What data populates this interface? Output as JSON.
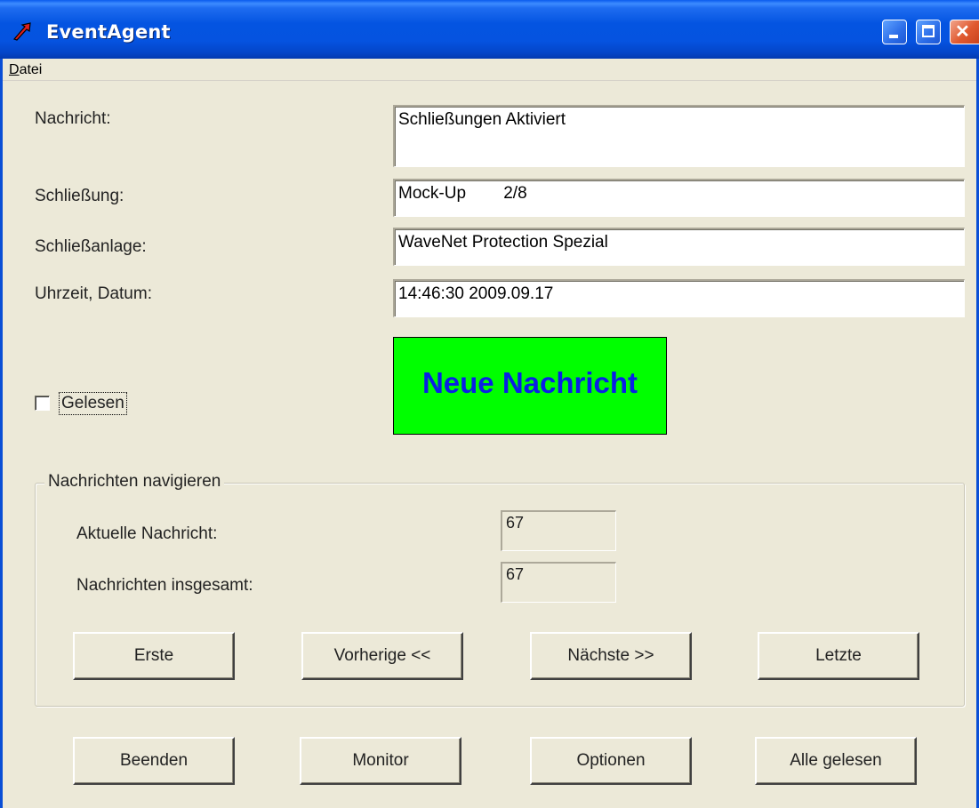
{
  "window": {
    "title": "EventAgent",
    "menu": {
      "file_prefix": "D",
      "file_rest": "atei"
    }
  },
  "form": {
    "message_label": "Nachricht:",
    "message_value": "Schließungen Aktiviert",
    "lock_label": "Schließung:",
    "lock_value": "Mock-Up        2/8",
    "system_label": "Schließanlage:",
    "system_value": "WaveNet Protection Spezial",
    "time_label": "Uhrzeit, Datum:",
    "time_value": "14:46:30 2009.09.17"
  },
  "status": {
    "text": "Neue Nachricht",
    "bg_color": "#00FF00",
    "text_color": "#0A1FE6"
  },
  "read_checkbox": {
    "label": "Gelesen",
    "checked": false
  },
  "navigation": {
    "group_title": "Nachrichten navigieren",
    "current_label": "Aktuelle Nachricht:",
    "current_value": "67",
    "total_label": "Nachrichten insgesamt:",
    "total_value": "67",
    "first_button": "Erste",
    "prev_button": "Vorherige <<",
    "next_button": "Nächste >>",
    "last_button": "Letzte"
  },
  "actions": {
    "quit_button": "Beenden",
    "monitor_button": "Monitor",
    "options_button": "Optionen",
    "all_read_button": "Alle gelesen"
  },
  "icons": {
    "app": "red-arrow-icon",
    "minimize": "minimize-icon",
    "maximize": "maximize-icon",
    "close": "close-icon"
  },
  "colors": {
    "titlebar": "#0454E1",
    "window_bg": "#ECE9D8"
  }
}
